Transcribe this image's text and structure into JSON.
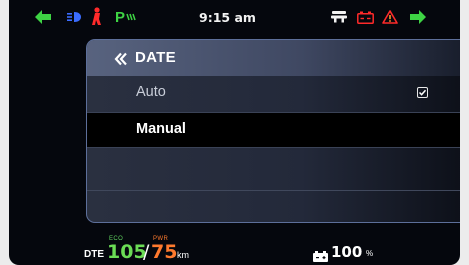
{
  "status_bar": {
    "time": "9:15 am",
    "parking_light_label": "P",
    "icons": [
      "arrow-left-icon",
      "headlight-icon",
      "kickstand-icon",
      "parking-light-icon",
      "fog-light-icon",
      "battery-warning-icon",
      "warning-triangle-icon",
      "arrow-right-icon"
    ]
  },
  "menu": {
    "title": "DATE",
    "back_icon": "double-chevron-left-icon",
    "options": [
      {
        "label": "Auto",
        "checked": true
      },
      {
        "label": "Manual",
        "selected": true
      }
    ]
  },
  "bottom_bar": {
    "dte_label": "DTE",
    "eco_label": "ECO",
    "eco_value": "105",
    "separator": "/",
    "pwr_label": "PWR",
    "pwr_value": "75",
    "unit": "km",
    "battery_value": "100",
    "battery_unit": "%"
  },
  "colors": {
    "turn_signal": "#3ed444",
    "eco": "#6bdc55",
    "pwr": "#ff7a2e",
    "warning": "#ff2a2a",
    "headlight": "#3b6cff"
  }
}
